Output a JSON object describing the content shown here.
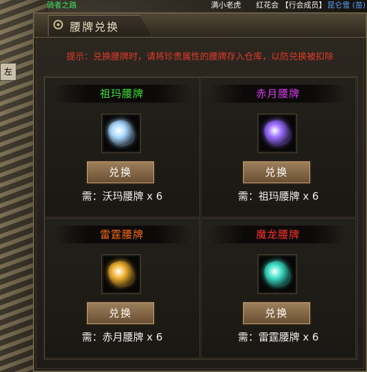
{
  "status_bar": {
    "location": "骑者之路",
    "player_name": "满小老虎",
    "guild": "红花会 【行会成员】",
    "other_name": "昆仑雪 (苗)"
  },
  "minimap_label": "左",
  "window": {
    "title": "腰牌兑换",
    "tip": "提示：兑换腰牌时，请将珍贵属性的腰牌存入仓库，以防兑换被扣除"
  },
  "items": [
    {
      "name": "祖玛腰牌",
      "name_color": "#3ee23a",
      "icon": "zuma-badge-icon",
      "gem_color": "#a9d8ff",
      "button": "兑换",
      "requirement": "需：沃玛腰牌 x 6"
    },
    {
      "name": "赤月腰牌",
      "name_color": "#d83cf0",
      "icon": "chiyue-badge-icon",
      "gem_color": "#9a6cff",
      "button": "兑换",
      "requirement": "需：祖玛腰牌 x 6"
    },
    {
      "name": "雷霆腰牌",
      "name_color": "#ff6a1a",
      "icon": "leiting-badge-icon",
      "gem_color": "#f0b030",
      "button": "兑换",
      "requirement": "需：赤月腰牌 x 6"
    },
    {
      "name": "魔龙腰牌",
      "name_color": "#ff3030",
      "icon": "molong-badge-icon",
      "gem_color": "#3ee0c8",
      "button": "兑换",
      "requirement": "需：雷霆腰牌 x 6"
    }
  ]
}
